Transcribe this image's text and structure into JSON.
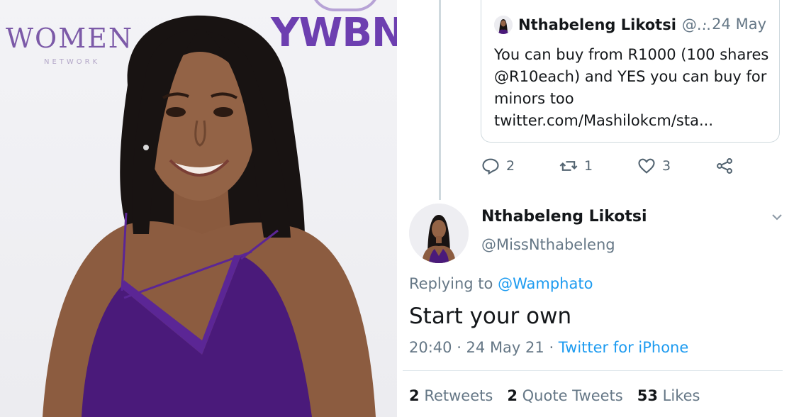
{
  "photo": {
    "backdrop_brand_left": "WOMEN",
    "backdrop_brand_left_sub": "NETWORK",
    "backdrop_brand_right": "YWBN",
    "dress_color": "#4a1a7a"
  },
  "quoted_tweet": {
    "author_name": "Nthabeleng Likotsi",
    "author_handle": "@...",
    "date": "· 24 May",
    "text": "You can buy from R1000 (100 shares @R10each) and YES you can buy for minors too twitter.com/Mashilokcm/sta...",
    "actions": [
      {
        "icon": "reply-icon",
        "count": "2"
      },
      {
        "icon": "retweet-icon",
        "count": "1"
      },
      {
        "icon": "like-icon",
        "count": "3"
      },
      {
        "icon": "share-icon",
        "count": ""
      }
    ]
  },
  "main_tweet": {
    "author_name": "Nthabeleng Likotsi",
    "author_handle": "@MissNthabeleng",
    "replying_prefix": "Replying to",
    "replying_to": "@Wamphato",
    "text": "Start your own",
    "timestamp": "20:40 · 24 May 21",
    "meta_sep": " · ",
    "source": "Twitter for iPhone",
    "stats": {
      "retweets_count": "2",
      "retweets_label": "Retweets",
      "quotes_count": "2",
      "quotes_label": "Quote Tweets",
      "likes_count": "53",
      "likes_label": "Likes"
    }
  },
  "colors": {
    "link": "#1d9bf0",
    "secondary_text": "#657786",
    "brand_purple": "#6d3fb0"
  }
}
